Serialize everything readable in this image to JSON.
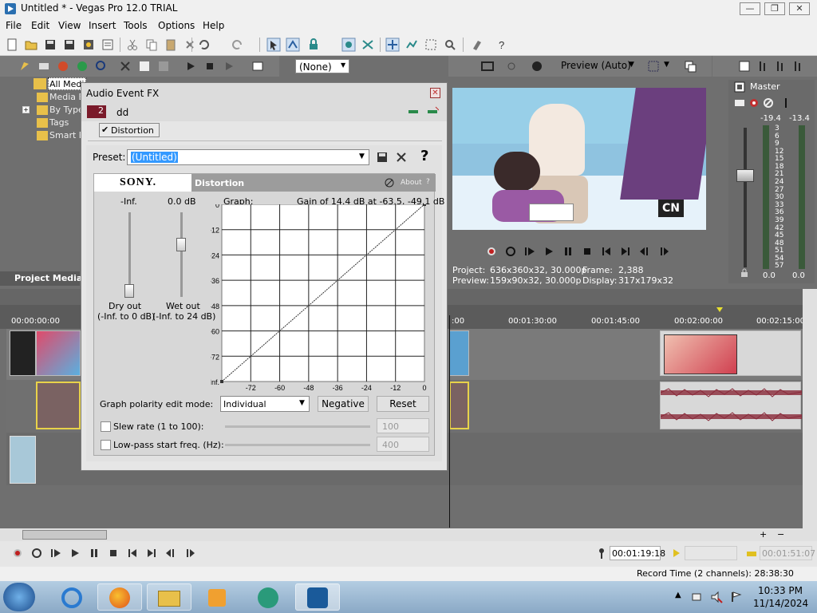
{
  "window": {
    "title": "Untitled * - Vegas Pro 12.0 TRIAL",
    "min": "—",
    "max": "❐",
    "close": "✕"
  },
  "menu": [
    "File",
    "Edit",
    "View",
    "Insert",
    "Tools",
    "Options",
    "Help"
  ],
  "toolbar_right": {
    "none_select": "(None)",
    "preview_mode": "Preview (Auto)"
  },
  "explorer": {
    "items": [
      "All Media",
      "Media B",
      "By Type",
      "Tags",
      "Smart B"
    ],
    "tab": "Project Media"
  },
  "preview": {
    "project_label": "Project:",
    "project_value": "636x360x32, 30.000p",
    "preview_label": "Preview:",
    "preview_value": "159x90x32, 30.000p",
    "frame_label": "Frame:",
    "frame_value": "2,388",
    "display_label": "Display:",
    "display_value": "317x179x32",
    "channel_logo": "CN"
  },
  "master": {
    "label": "Master",
    "left_peak": "-19.4",
    "right_peak": "-13.4",
    "left_level": "0.0",
    "right_level": "0.0",
    "scale": [
      "3",
      "6",
      "9",
      "12",
      "15",
      "18",
      "21",
      "24",
      "27",
      "30",
      "33",
      "36",
      "39",
      "42",
      "45",
      "48",
      "51",
      "54",
      "57"
    ]
  },
  "timeline": {
    "marks": [
      "00:00:00:00",
      "00:01:30:00",
      "00:01:45:00",
      "00:02:00:00",
      "00:02:15:00"
    ],
    "partial_mark": ":00"
  },
  "dialog": {
    "title": "Audio Event FX",
    "track_number": "2",
    "event_name": "dd",
    "plugin_chain_item": "Distortion",
    "preset_label": "Preset:",
    "preset_value": "(Untitled)",
    "help_symbol": "?",
    "brand": "SONY.",
    "plugin_name": "Distortion",
    "about": "About",
    "dry_value": "-Inf.",
    "wet_value": "0.0 dB",
    "dry_label": "Dry out",
    "dry_range": "(-Inf. to 0 dB)",
    "wet_label": "Wet out",
    "wet_range": "(-Inf. to 24 dB)",
    "graph_label": "Graph:",
    "graph_info": "Gain of 14.4 dB at -63.5, -49.1 dB",
    "y_ticks": [
      "0",
      "-12",
      "-24",
      "-36",
      "-48",
      "-60",
      "-72",
      "-Inf."
    ],
    "x_ticks": [
      "-72",
      "-60",
      "-48",
      "-36",
      "-24",
      "-12",
      "0"
    ],
    "polarity_label": "Graph polarity edit mode:",
    "polarity_value": "Individual",
    "negative_btn": "Negative",
    "reset_btn": "Reset",
    "slew_label": "Slew rate (1 to 100):",
    "slew_value": "100",
    "lowpass_label": "Low-pass start freq. (Hz):",
    "lowpass_value": "400"
  },
  "transport": {
    "time": "00:01:19:18",
    "end_time": "00:01:51:07",
    "record_time": "Record Time (2 channels): 28:38:30"
  },
  "taskbar": {
    "time": "10:33 PM",
    "date": "11/14/2024"
  },
  "colors": {
    "dark_panel": "#6f6f6f",
    "selection": "#3399ff",
    "video_clip_bg": "#d8d8d8",
    "audio_wave": "#8a2a3a"
  }
}
